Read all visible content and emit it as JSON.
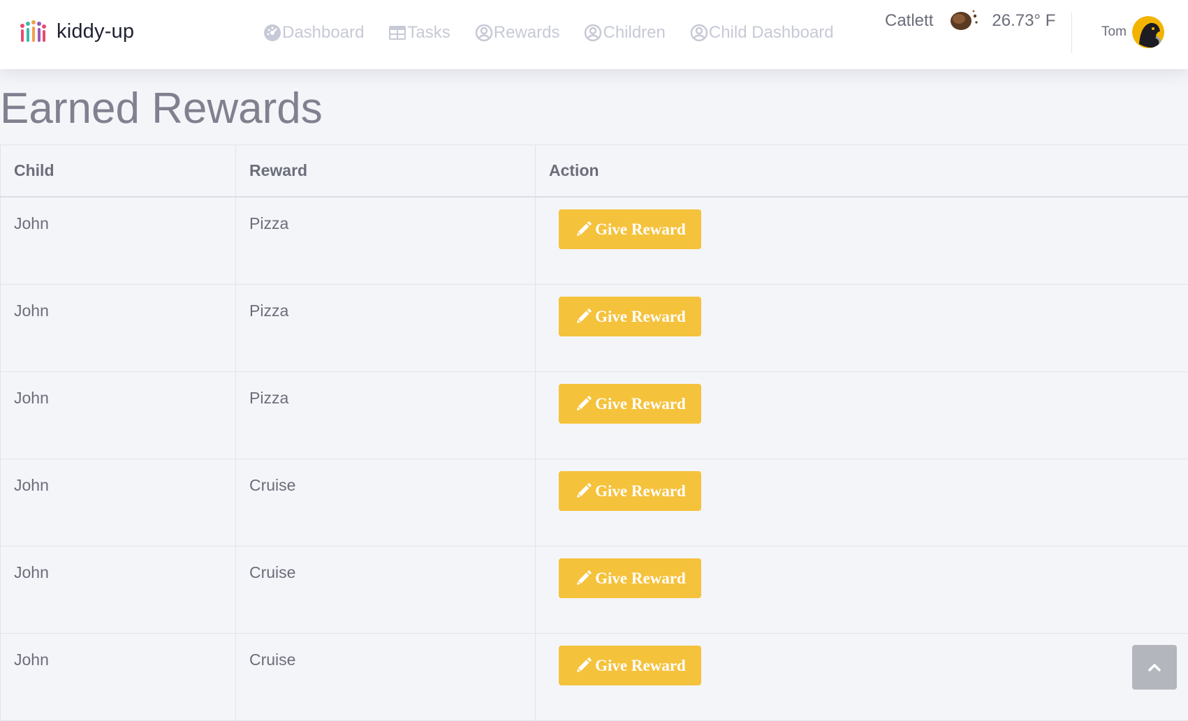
{
  "app": {
    "name": "kiddy-up"
  },
  "nav": [
    {
      "label": "Dashboard",
      "icon": "gauge-icon"
    },
    {
      "label": "Tasks",
      "icon": "table-icon"
    },
    {
      "label": "Rewards",
      "icon": "user-circle-icon"
    },
    {
      "label": "Children",
      "icon": "user-circle-icon"
    },
    {
      "label": "Child Dashboard",
      "icon": "user-circle-icon"
    }
  ],
  "weather": {
    "city": "Catlett",
    "temperature": "26.73° F",
    "icon": "weather-icon"
  },
  "user": {
    "name": "Tom",
    "avatar_icon": "avatar-icon"
  },
  "page": {
    "title": "Earned Rewards"
  },
  "table": {
    "headers": [
      "Child",
      "Reward",
      "Action"
    ],
    "rows": [
      {
        "child": "John",
        "reward": "Pizza",
        "action_label": "Give Reward"
      },
      {
        "child": "John",
        "reward": "Pizza",
        "action_label": "Give Reward"
      },
      {
        "child": "John",
        "reward": "Pizza",
        "action_label": "Give Reward"
      },
      {
        "child": "John",
        "reward": "Cruise",
        "action_label": "Give Reward"
      },
      {
        "child": "John",
        "reward": "Cruise",
        "action_label": "Give Reward"
      },
      {
        "child": "John",
        "reward": "Cruise",
        "action_label": "Give Reward"
      }
    ]
  },
  "colors": {
    "accent_button": "#f5c23c",
    "nav_inactive": "#c7c9d6",
    "page_background": "#f4f5f9",
    "scroll_top_button": "#b4b6bd"
  },
  "scroll_top": {
    "icon": "chevron-up-icon"
  }
}
